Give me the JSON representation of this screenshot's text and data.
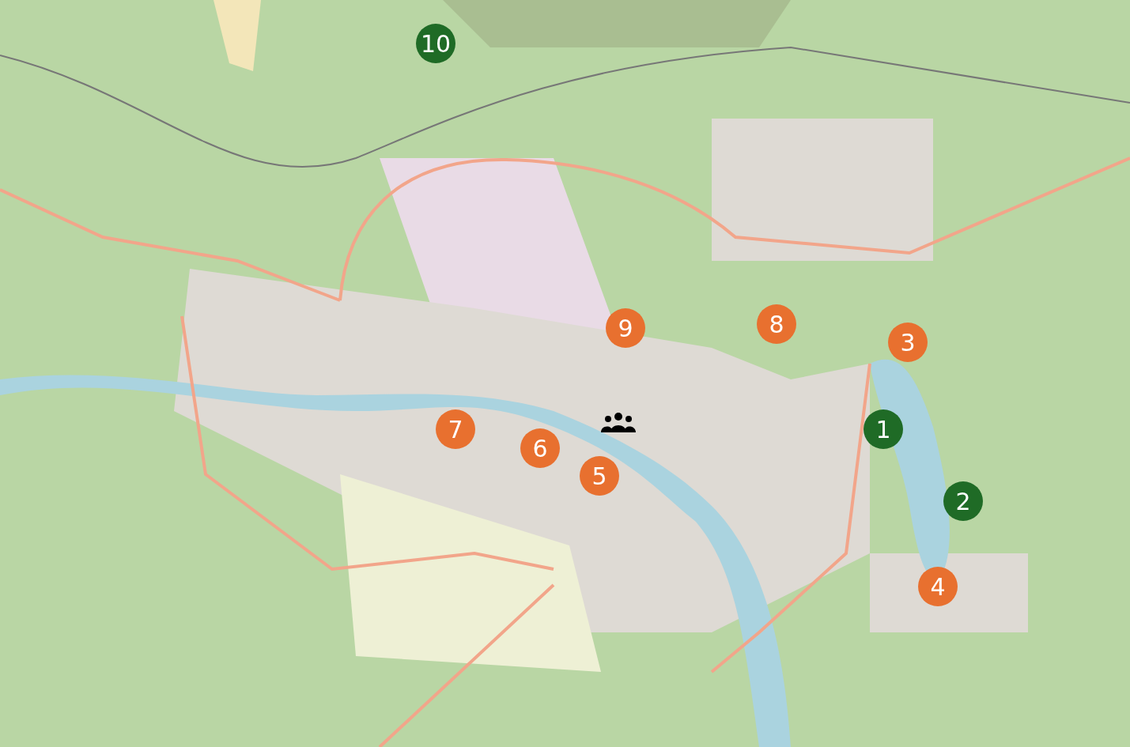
{
  "markers": [
    {
      "label": "10",
      "color": "#1f6b26"
    },
    {
      "label": "9",
      "color": "#e8702f"
    },
    {
      "label": "8",
      "color": "#e8702f"
    },
    {
      "label": "3",
      "color": "#e8702f"
    },
    {
      "label": "7",
      "color": "#e8702f"
    },
    {
      "label": "1",
      "color": "#1f6b26"
    },
    {
      "label": "6",
      "color": "#e8702f"
    },
    {
      "label": "5",
      "color": "#e8702f"
    },
    {
      "label": "2",
      "color": "#1f6b26"
    },
    {
      "label": "4",
      "color": "#e8702f"
    }
  ]
}
